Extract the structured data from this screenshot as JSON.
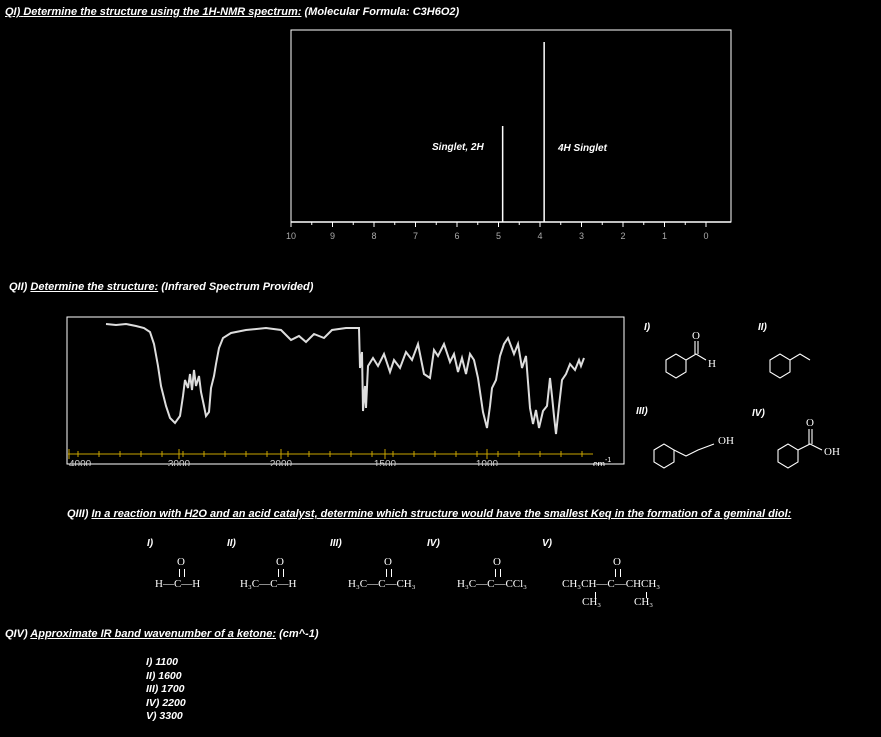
{
  "q1": {
    "label": "QI)",
    "prompt": "Determine the structure using the 1H-NMR spectrum:",
    "formula": "(Molecular Formula: C3H6O2)",
    "peaks": [
      {
        "ppm": 4.9,
        "label": "Singlet, 2H"
      },
      {
        "ppm": 3.9,
        "label": "4H  Singlet"
      }
    ],
    "axis_ticks": [
      "10",
      "9",
      "8",
      "7",
      "6",
      "5",
      "4",
      "3",
      "2",
      "1",
      "0"
    ]
  },
  "q2": {
    "label": "QII)",
    "prompt": "Determine the structure:",
    "note": "(Infrared Spectrum Provided)",
    "axis_ticks": [
      "4000",
      "3000",
      "2000",
      "1500",
      "1000"
    ],
    "unit": "cm",
    "unit_exp": "-1",
    "options": [
      {
        "label": "I)",
        "name": "benzaldehyde",
        "atom": "H",
        "o": "O"
      },
      {
        "label": "II)",
        "name": "ethylbenzene"
      },
      {
        "label": "III)",
        "name": "2-phenylethanol",
        "atom": "OH"
      },
      {
        "label": "IV)",
        "name": "benzoic acid",
        "atom": "OH",
        "o": "O"
      }
    ]
  },
  "q3": {
    "label": "QIII)",
    "prompt": "In a reaction with H2O and an acid catalyst, determine which structure would have the smallest Keq in the formation of a geminal diol:",
    "options": [
      {
        "label": "I)",
        "o": "O",
        "line": "H—C—H"
      },
      {
        "label": "II)",
        "o": "O",
        "line": "H₃C—C—H"
      },
      {
        "label": "III)",
        "o": "O",
        "line": "H₃C—C—CH₃"
      },
      {
        "label": "IV)",
        "o": "O",
        "line": "H₃C—C—CCl₃"
      },
      {
        "label": "V)",
        "o": "O",
        "line": "CH₃CH—C—CHCH₃",
        "sub1": "CH₃",
        "sub2": "CH₃"
      }
    ]
  },
  "q4": {
    "label": "QIV)",
    "prompt": "Approximate IR band wavenumber of a ketone:",
    "units": "(cm^-1)",
    "options": [
      "I)  1100",
      "II)  1600",
      "III) 1700",
      "IV) 2200",
      "V) 3300"
    ]
  }
}
